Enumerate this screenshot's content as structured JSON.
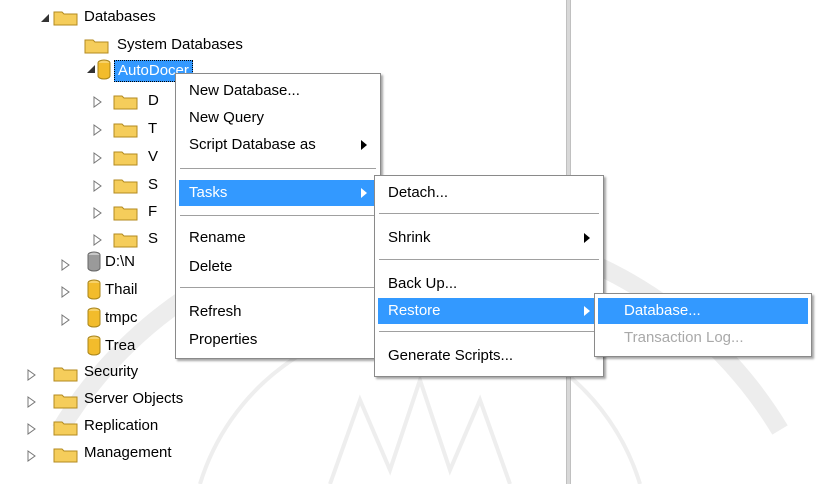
{
  "tree": {
    "databases_label": "Databases",
    "system_databases_label": "System Databases",
    "autodoc_label": "AutoDocer",
    "child_initials": [
      "D",
      "T",
      "V",
      "S",
      "F",
      "S"
    ],
    "db_dnm_label": "D:\\N",
    "db_thai_label": "Thail",
    "db_tmp_label": "tmpc",
    "db_trea_label": "Trea",
    "security_label": "Security",
    "server_objects_label": "Server Objects",
    "replication_label": "Replication",
    "management_label": "Management"
  },
  "context_menu": {
    "new_database": "New Database...",
    "new_query": "New Query",
    "script_database_as": "Script Database as",
    "tasks": "Tasks",
    "rename": "Rename",
    "delete": "Delete",
    "refresh": "Refresh",
    "properties": "Properties"
  },
  "tasks_menu": {
    "detach": "Detach...",
    "shrink": "Shrink",
    "back_up": "Back Up...",
    "restore": "Restore",
    "generate_scripts": "Generate Scripts..."
  },
  "restore_menu": {
    "database": "Database...",
    "transaction_log": "Transaction Log..."
  },
  "colors": {
    "highlight": "#3399ff",
    "folder": "#f2c14e",
    "disabled": "#a9a9a9"
  }
}
